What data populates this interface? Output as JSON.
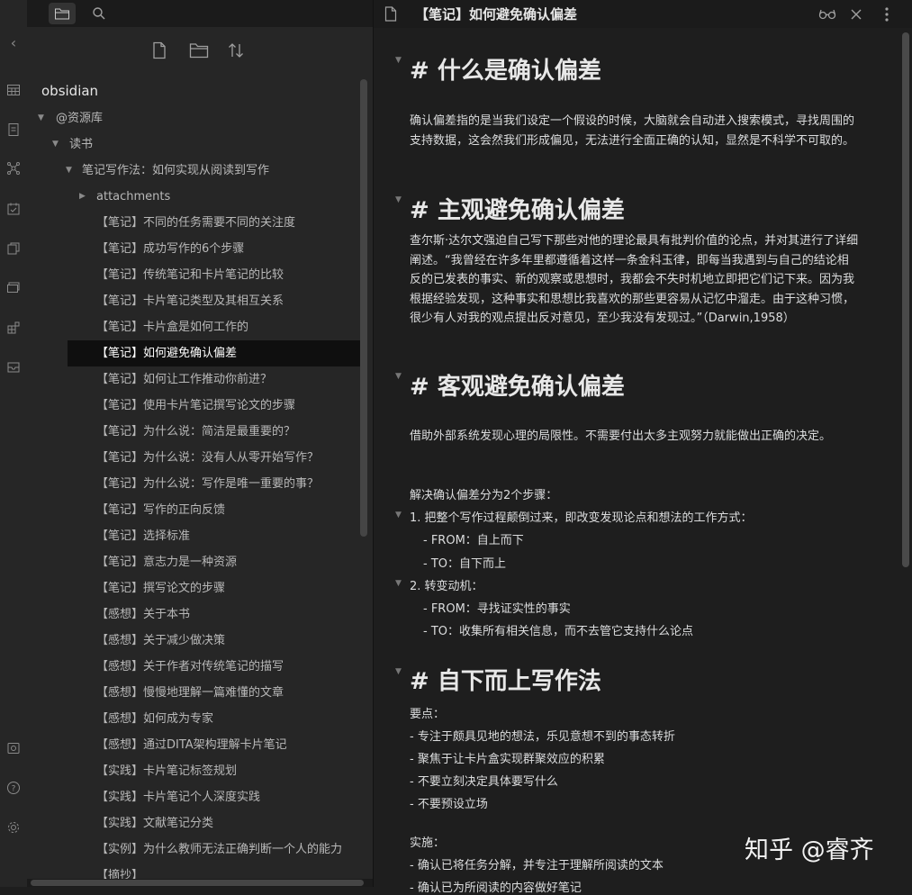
{
  "sidebar": {
    "vault_name": "obsidian",
    "tree": [
      {
        "label": "@资源库",
        "type": "folder-open"
      },
      {
        "label": "读书",
        "type": "folder-open"
      },
      {
        "label": "笔记写作法：如何实现从阅读到写作",
        "type": "folder-open"
      },
      {
        "label": "attachments",
        "type": "folder-closed"
      },
      {
        "label": "【笔记】不同的任务需要不同的关注度",
        "type": "file"
      },
      {
        "label": "【笔记】成功写作的6个步骤",
        "type": "file"
      },
      {
        "label": "【笔记】传统笔记和卡片笔记的比较",
        "type": "file"
      },
      {
        "label": "【笔记】卡片笔记类型及其相互关系",
        "type": "file"
      },
      {
        "label": "【笔记】卡片盒是如何工作的",
        "type": "file"
      },
      {
        "label": "【笔记】如何避免确认偏差",
        "type": "file",
        "active": true
      },
      {
        "label": "【笔记】如何让工作推动你前进？",
        "type": "file"
      },
      {
        "label": "【笔记】使用卡片笔记撰写论文的步骤",
        "type": "file"
      },
      {
        "label": "【笔记】为什么说：简洁是最重要的？",
        "type": "file"
      },
      {
        "label": "【笔记】为什么说：没有人从零开始写作？",
        "type": "file"
      },
      {
        "label": "【笔记】为什么说：写作是唯一重要的事？",
        "type": "file"
      },
      {
        "label": "【笔记】写作的正向反馈",
        "type": "file"
      },
      {
        "label": "【笔记】选择标准",
        "type": "file"
      },
      {
        "label": "【笔记】意志力是一种资源",
        "type": "file"
      },
      {
        "label": "【笔记】撰写论文的步骤",
        "type": "file"
      },
      {
        "label": "【感想】关于本书",
        "type": "file"
      },
      {
        "label": "【感想】关于减少做决策",
        "type": "file"
      },
      {
        "label": "【感想】关于作者对传统笔记的描写",
        "type": "file"
      },
      {
        "label": "【感想】慢慢地理解一篇难懂的文章",
        "type": "file"
      },
      {
        "label": "【感想】如何成为专家",
        "type": "file"
      },
      {
        "label": "【感想】通过DITA架构理解卡片笔记",
        "type": "file"
      },
      {
        "label": "【实践】卡片笔记标签规划",
        "type": "file"
      },
      {
        "label": "【实践】卡片笔记个人深度实践",
        "type": "file"
      },
      {
        "label": "【实践】文献笔记分类",
        "type": "file"
      },
      {
        "label": "【实例】为什么教师无法正确判断一个人的能力",
        "type": "file"
      },
      {
        "label": "【摘抄】",
        "type": "file"
      }
    ]
  },
  "main": {
    "title": "【笔记】如何避免确认偏差",
    "headings": [
      "# 什么是确认偏差",
      "# 主观避免确认偏差",
      "# 客观避免确认偏差",
      "# 自下而上写作法"
    ],
    "p1": "确认偏差指的是当我们设定一个假设的时候，大脑就会自动进入搜索模式，寻找周围的支持数据，这会然我们形成偏见，无法进行全面正确的认知，显然是不科学不可取的。",
    "p2": "查尔斯·达尔文强迫自己写下那些对他的理论最具有批判价值的论点，并对其进行了详细阐述。“我曾经在许多年里都遵循着这样一条金科玉律，即每当我遇到与自己的结论相反的已发表的事实、新的观察或思想时，我都会不失时机地立即把它们记下来。因为我根据经验发现，这种事实和思想比我喜欢的那些更容易从记忆中溜走。由于这种习惯，很少有人对我的观点提出反对意见，至少我没有发现过。”（Darwin,1958）",
    "p3": "借助外部系统发现心理的局限性。不需要付出太多主观努力就能做出正确的决定。",
    "steps_intro": "解决确认偏差分为2个步骤：",
    "step1": "1. 把整个写作过程颠倒过来，即改变发现论点和想法的工作方式：",
    "step1_from": "- FROM：自上而下",
    "step1_to": "- TO：自下而上",
    "step2": "2. 转变动机：",
    "step2_from": "- FROM：寻找证实性的事实",
    "step2_to": "- TO：收集所有相关信息，而不去管它支持什么论点",
    "key_points_label": "要点：",
    "key_points": [
      "- 专注于颇具见地的想法，乐见意想不到的事态转折",
      "- 聚焦于让卡片盒实现群聚效应的积累",
      "- 不要立刻决定具体要写什么",
      "- 不要预设立场"
    ],
    "impl_label": "实施：",
    "impl": [
      "- 确认已将任务分解，并专注于理解所阅读的文本",
      "- 确认已为所阅读的内容做好笔记"
    ]
  },
  "watermark": "知乎 @睿齐"
}
